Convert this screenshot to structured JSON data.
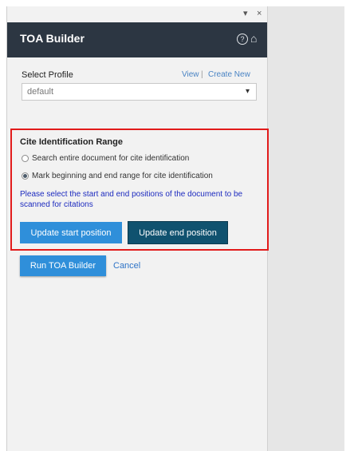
{
  "window": {
    "dropdown_glyph": "▾",
    "close_glyph": "×"
  },
  "header": {
    "title": "TOA Builder",
    "help_glyph": "?",
    "home_glyph": "⌂"
  },
  "profile": {
    "label": "Select Profile",
    "view_link": "View",
    "separator": "|",
    "create_new_link": "Create New",
    "selected": "default",
    "chevron": "▾"
  },
  "cite_range": {
    "title": "Cite Identification Range",
    "options": [
      {
        "label": "Search entire document for cite identification",
        "selected": false
      },
      {
        "label": "Mark beginning and end range for cite identification",
        "selected": true
      }
    ],
    "note": "Please select the start and end positions of the document to be scanned for citations",
    "update_start": "Update start position",
    "update_end": "Update end position"
  },
  "actions": {
    "run": "Run TOA Builder",
    "cancel": "Cancel"
  },
  "colors": {
    "header_bg": "#2c3642",
    "accent_blue": "#2f8fda",
    "dark_button": "#10526f",
    "highlight_border": "#e21b1b",
    "note_text": "#1d2bbf"
  }
}
